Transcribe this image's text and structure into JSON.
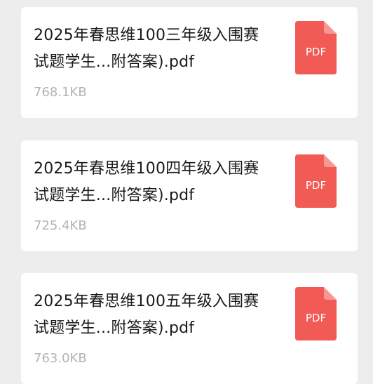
{
  "files": [
    {
      "name": "2025年春思维100三年级入围赛试题学生...附答案).pdf",
      "size": "768.1KB",
      "icon": "pdf-icon",
      "icon_label": "PDF"
    },
    {
      "name": "2025年春思维100四年级入围赛试题学生...附答案).pdf",
      "size": "725.4KB",
      "icon": "pdf-icon",
      "icon_label": "PDF"
    },
    {
      "name": "2025年春思维100五年级入围赛试题学生...附答案).pdf",
      "size": "763.0KB",
      "icon": "pdf-icon",
      "icon_label": "PDF"
    }
  ],
  "colors": {
    "background": "#ededed",
    "card": "#ffffff",
    "pdf_red": "#f25a55",
    "pdf_fold": "#f69894",
    "text_primary": "#1a1a1a",
    "text_secondary": "#b3b3b3"
  }
}
